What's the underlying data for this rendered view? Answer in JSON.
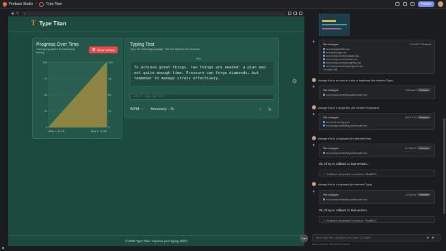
{
  "topbar": {
    "app_name": "Firebase Studio",
    "project_name": "Type Titan",
    "publish_label": "Publish"
  },
  "browser": {
    "url": "/"
  },
  "app": {
    "title": "Type Titan",
    "progress": {
      "title": "Progress Over Time",
      "subtitle": "Your typing speed and accuracy history.",
      "clear_label": "Clear History"
    },
    "typing": {
      "title": "Typing Test",
      "subtitle": "Type the following passage. The test lasts for 60 seconds.",
      "timer": "60s",
      "passage": "To achieve great things, two things are needed: a plan and not quite enough time. Pressure can forge diamonds, but remember to manage stress effectively.",
      "input_placeholder": "Start typing here...",
      "wpm": "WPM: --",
      "accuracy": "Accuracy: --%"
    },
    "footer": "© 2025 Type Titan. Improve your typing skills!"
  },
  "chart_data": {
    "type": "area",
    "x": [
      "May 1, 12:49",
      "May 1, 12:55"
    ],
    "series": [
      {
        "values": [
          0,
          100
        ],
        "color": "#c98a3a"
      },
      {
        "values": [
          0,
          100
        ],
        "color": "#6b8f4e"
      }
    ],
    "left_ticks": [
      "100",
      "75",
      "50",
      "25",
      "0"
    ],
    "right_ticks": [
      "100",
      "75",
      "50",
      "25",
      "0"
    ],
    "ylim": [
      0,
      100
    ]
  },
  "panel": {
    "fc1": {
      "title": "File changes",
      "hash": "7f4a8f571",
      "status": "Current",
      "files": [
        "src/app/globals.css",
        "src/app/page.tsx",
        "src/components/header.tsx",
        "src/components/footer.tsx",
        "src/components/progress.tsx",
        "src/components/typing-test.tsx"
      ],
      "more": "+4 more file"
    },
    "msg1": "change this to an icon of a key or keyboard (for element Type)",
    "fc2": {
      "title": "File changes",
      "hash": "33bbaa2f",
      "restore": "Restore",
      "files": [
        "src/components/layout/header.tsx"
      ]
    },
    "msg2": "change this to a single key (for element Keyboard)",
    "fc3": {
      "title": "File changes",
      "hash": "862d7b0f",
      "restore": "Restore",
      "files": [
        "src/next.config.json",
        "src/components/layout/header.tsx"
      ]
    },
    "msg3": "change this to a keyboard (for element Key)",
    "fc4": {
      "title": "File changes",
      "hash": "bf780b29",
      "restore": "Restore",
      "files": [
        "src/components/layout/header.tsx"
      ]
    },
    "reply1": "Ok, I'll try to rollback to that version...",
    "rollback1": "Rollback completed to version: 7f4a8f571",
    "msg4": "change this to a keyboard (for element Type)",
    "fc5": {
      "title": "File changes",
      "hash": "423bd9fe",
      "restore": "Restore",
      "files": [
        "src/components/layout/header.tsx"
      ]
    },
    "reply2": "Ok, I'll try to rollback to that version...",
    "rollback2": "Rollback completed to version: 7f4a8f571",
    "chat_placeholder": "Describe the changes you want to make",
    "hint": "Submit with Enter. Shift+Enter for new line.",
    "avatar_label": "Tab"
  }
}
